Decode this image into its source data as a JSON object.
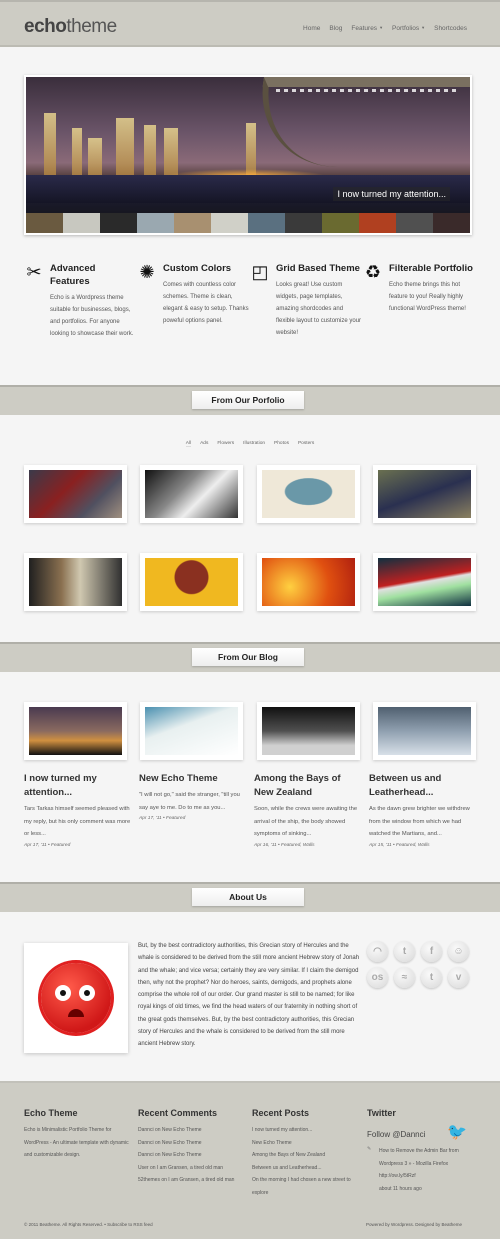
{
  "header": {
    "logo_bold": "echo",
    "logo_light": "theme",
    "nav": [
      "Home",
      "Blog",
      "Features",
      "Portfolios",
      "Shortcodes"
    ]
  },
  "slider": {
    "caption": "I now turned my attention..."
  },
  "features": [
    {
      "icon": "tools-icon",
      "title": "Advanced Features",
      "text": "Echo is a Wordpress theme suitable for businesses, blogs, and portfolios. For anyone looking to showcase their work."
    },
    {
      "icon": "color-wheel-icon",
      "title": "Custom Colors",
      "text": "Comes with countless color schemes. Theme is clean, elegant & easy to setup. Thanks poweful options panel."
    },
    {
      "icon": "grid-icon",
      "title": "Grid Based Theme",
      "text": "Looks great! Use custom widgets, page templates, amazing shordcodes and flexible layout to customize your website!"
    },
    {
      "icon": "refresh-icon",
      "title": "Filterable Portfolio",
      "text": "Echo theme brings this hot feature to you! Really highly functional WordPress theme!"
    }
  ],
  "portfolio": {
    "title": "From Our Porfolio",
    "filters": [
      "All",
      "Ads",
      "Flowers",
      "Illustration",
      "Photos",
      "Posters"
    ]
  },
  "blog": {
    "title": "From Our Blog",
    "posts": [
      {
        "title": "I now turned my attention...",
        "excerpt": "Tars Tarkas himself seemed pleased with my reply, but his only comment was more or less...",
        "meta": "Apr 17, '11 • Featured"
      },
      {
        "title": "New Echo Theme",
        "excerpt": "\"I will not go,\" said the stranger, \"till you say aye to me. Do to me as you...",
        "meta": "Apr 17, '11 • Featured"
      },
      {
        "title": "Among the Bays of New Zealand",
        "excerpt": "Soon, while the crews were awaiting the arrival of the ship, the body showed symptoms of sinking...",
        "meta": "Apr 16, '11 • Featured, Walls"
      },
      {
        "title": "Between us and Leatherhead...",
        "excerpt": "As the dawn grew brighter we withdrew from the window from which we had watched the Martians, and...",
        "meta": "Apr 15, '11 • Featured, Walls"
      }
    ]
  },
  "about": {
    "title": "About Us",
    "text": "But, by the best contradictory authorities, this Grecian story of Hercules and the whale is considered to be derived from the still more ancient Hebrew story of Jonah and the whale; and vice versa; certainly they are very similar. If I claim the demigod then, why not the prophet? Nor do heroes, saints, demigods, and prophets alone comprise the whole roll of our order. Our grand master is still to be named; for like royal kings of old times, we find the head waters of our fraternity in nothing short of the great gods themselves. But, by the best contradictory authorities, this Grecian story of Hercules and the whale is considered to be derived from the still more ancient Hebrew story.",
    "social": [
      {
        "name": "rss-icon",
        "glyph": "◠"
      },
      {
        "name": "twitter-icon",
        "glyph": "t"
      },
      {
        "name": "facebook-icon",
        "glyph": "f"
      },
      {
        "name": "digg-icon",
        "glyph": "☺"
      },
      {
        "name": "lastfm-icon",
        "glyph": "os"
      },
      {
        "name": "myspace-icon",
        "glyph": "≈"
      },
      {
        "name": "tumblr-icon",
        "glyph": "t"
      },
      {
        "name": "vimeo-icon",
        "glyph": "v"
      }
    ]
  },
  "footer": {
    "echo": {
      "title": "Echo Theme",
      "text": "Echo is Minimalistic Portfolio Theme for WordPress - An ultimate template with dynamic and customizable design."
    },
    "comments": {
      "title": "Recent Comments",
      "items": [
        "Dannci on New Echo Theme",
        "Dannci on New Echo Theme",
        "Dannci on New Echo Theme",
        "User on I am Gransen, a tired old man",
        "52themes on I am Gransen, a tired old man"
      ]
    },
    "posts": {
      "title": "Recent Posts",
      "items": [
        "I now turned my attention...",
        "New Echo Theme",
        "Among the Bays of New Zealand",
        "Between us and Leatherhead...",
        "On the morning I had chosen a new street to explore"
      ]
    },
    "twitter": {
      "title": "Twitter",
      "follow": "Follow @Dannci",
      "tweet": "How to Remove the Admin Bar from Wordpress 3 » - Mozilla Firefox",
      "link": "http://ow.ly/5tRzf",
      "time": "about 11 hours ago"
    },
    "copyright": "© 2011 Beatheme. All Rights Reserved. • Subscribe to RSS feed",
    "powered": "Powered by Wordpress. Designed by Beatheme"
  }
}
